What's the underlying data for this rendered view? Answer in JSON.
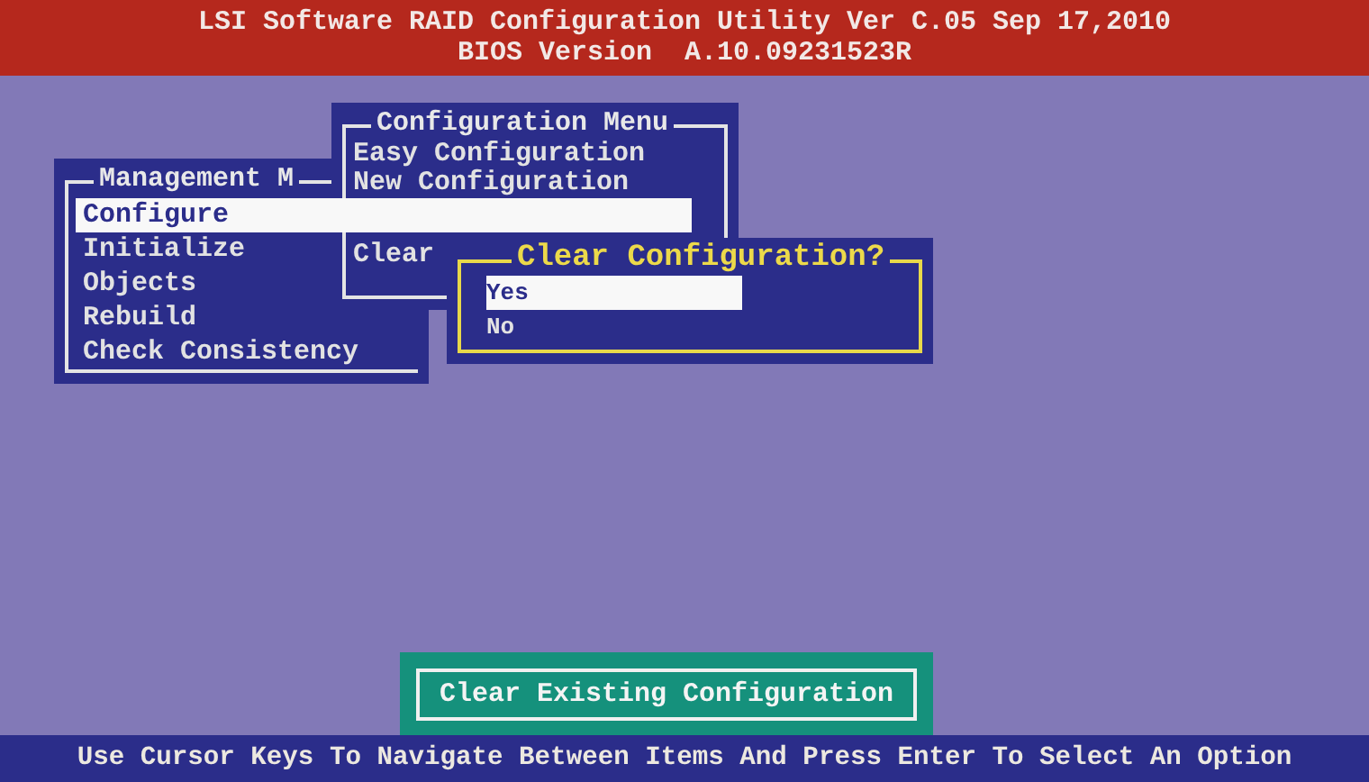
{
  "header": {
    "title": "LSI Software RAID Configuration Utility Ver C.05 Sep 17,2010",
    "subtitle": "BIOS Version  A.10.09231523R"
  },
  "windows": [
    {
      "kind": "menu",
      "title": "Management M",
      "items": [
        {
          "label": "Configure",
          "selected": true
        },
        {
          "label": "Initialize",
          "selected": false
        },
        {
          "label": "Objects",
          "selected": false
        },
        {
          "label": "Rebuild",
          "selected": false
        },
        {
          "label": "Check Consistency",
          "selected": false
        }
      ]
    },
    {
      "kind": "menu",
      "title": "Configuration Menu",
      "items": [
        {
          "label": "Easy Configuration",
          "selected": false
        },
        {
          "label": "New Configuration",
          "selected": false
        },
        {
          "label": "Clear",
          "selected": false
        }
      ]
    },
    {
      "kind": "dialog",
      "title": "Clear Configuration?",
      "items": [
        {
          "label": "Yes",
          "selected": true
        },
        {
          "label": "No",
          "selected": false
        }
      ]
    }
  ],
  "status_message": "Clear Existing Configuration",
  "help_bar": "Use Cursor Keys To Navigate Between Items And Press Enter To Select An Option"
}
